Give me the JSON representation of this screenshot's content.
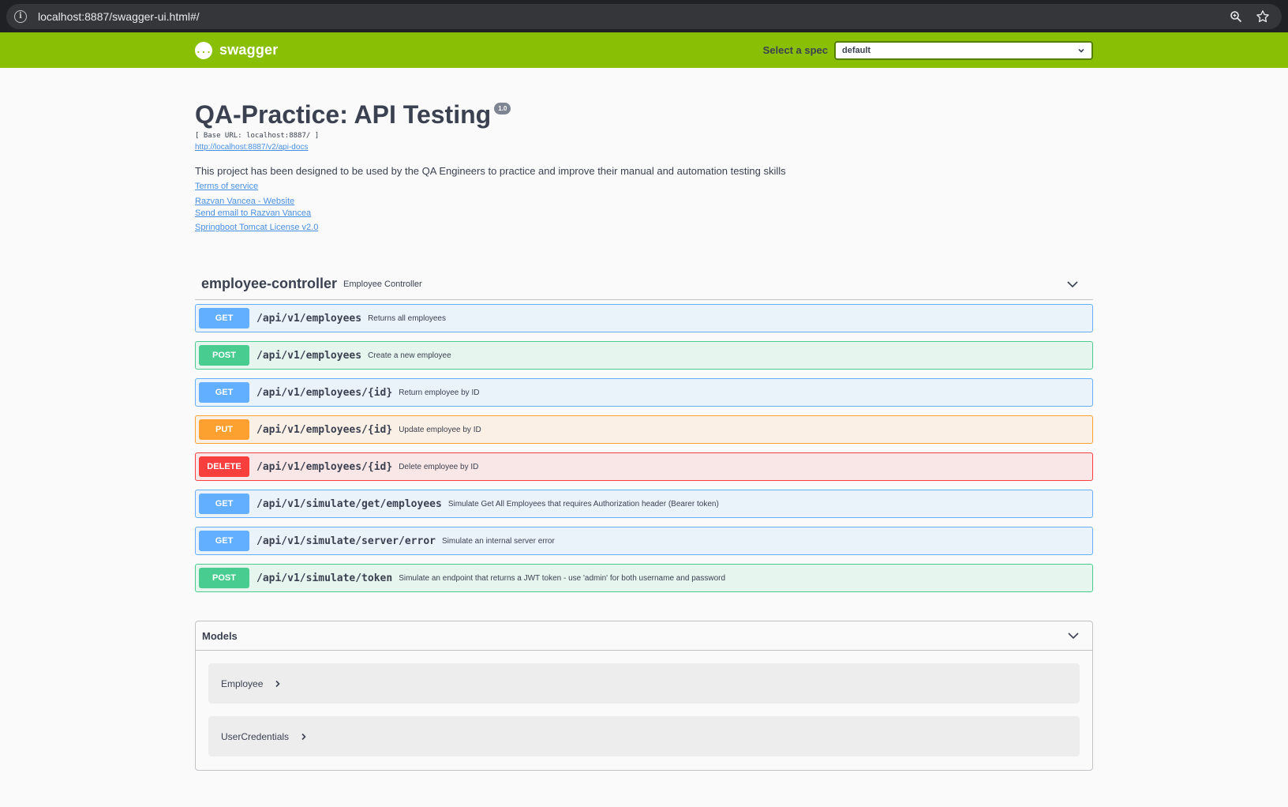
{
  "browser": {
    "url": "localhost:8887/swagger-ui.html#/",
    "icons": [
      "info-icon",
      "zoom-icon",
      "star-icon"
    ]
  },
  "topbar": {
    "logo_text": "swagger",
    "logo_icon": "{...}",
    "spec_label": "Select a spec",
    "spec_selected": "default"
  },
  "info": {
    "title": "QA-Practice: API Testing",
    "version": "1.0",
    "base_url": "[ Base URL: localhost:8887/ ]",
    "api_docs_link": "http://localhost:8887/v2/api-docs",
    "description": "This project has been designed to be used by the QA Engineers to practice and improve their manual and automation testing skills",
    "terms_link": "Terms of service",
    "website_link": "Razvan Vancea - Website",
    "email_link": "Send email to Razvan Vancea",
    "license_link": "Springboot Tomcat License v2.0"
  },
  "tag": {
    "name": "employee-controller",
    "description": "Employee Controller"
  },
  "operations": [
    {
      "method": "GET",
      "path": "/api/v1/employees",
      "summary": "Returns all employees"
    },
    {
      "method": "POST",
      "path": "/api/v1/employees",
      "summary": "Create a new employee"
    },
    {
      "method": "GET",
      "path": "/api/v1/employees/{id}",
      "summary": "Return employee by ID"
    },
    {
      "method": "PUT",
      "path": "/api/v1/employees/{id}",
      "summary": "Update employee by ID"
    },
    {
      "method": "DELETE",
      "path": "/api/v1/employees/{id}",
      "summary": "Delete employee by ID"
    },
    {
      "method": "GET",
      "path": "/api/v1/simulate/get/employees",
      "summary": "Simulate Get All Employees that requires Authorization header (Bearer token)"
    },
    {
      "method": "GET",
      "path": "/api/v1/simulate/server/error",
      "summary": "Simulate an internal server error"
    },
    {
      "method": "POST",
      "path": "/api/v1/simulate/token",
      "summary": "Simulate an endpoint that returns a JWT token - use 'admin' for both username and password"
    }
  ],
  "models": {
    "title": "Models",
    "items": [
      "Employee",
      "UserCredentials"
    ]
  },
  "colors": {
    "topbar": "#89bf04",
    "get": "#61affe",
    "post": "#49cc90",
    "put": "#fca130",
    "delete": "#f93e3e"
  }
}
